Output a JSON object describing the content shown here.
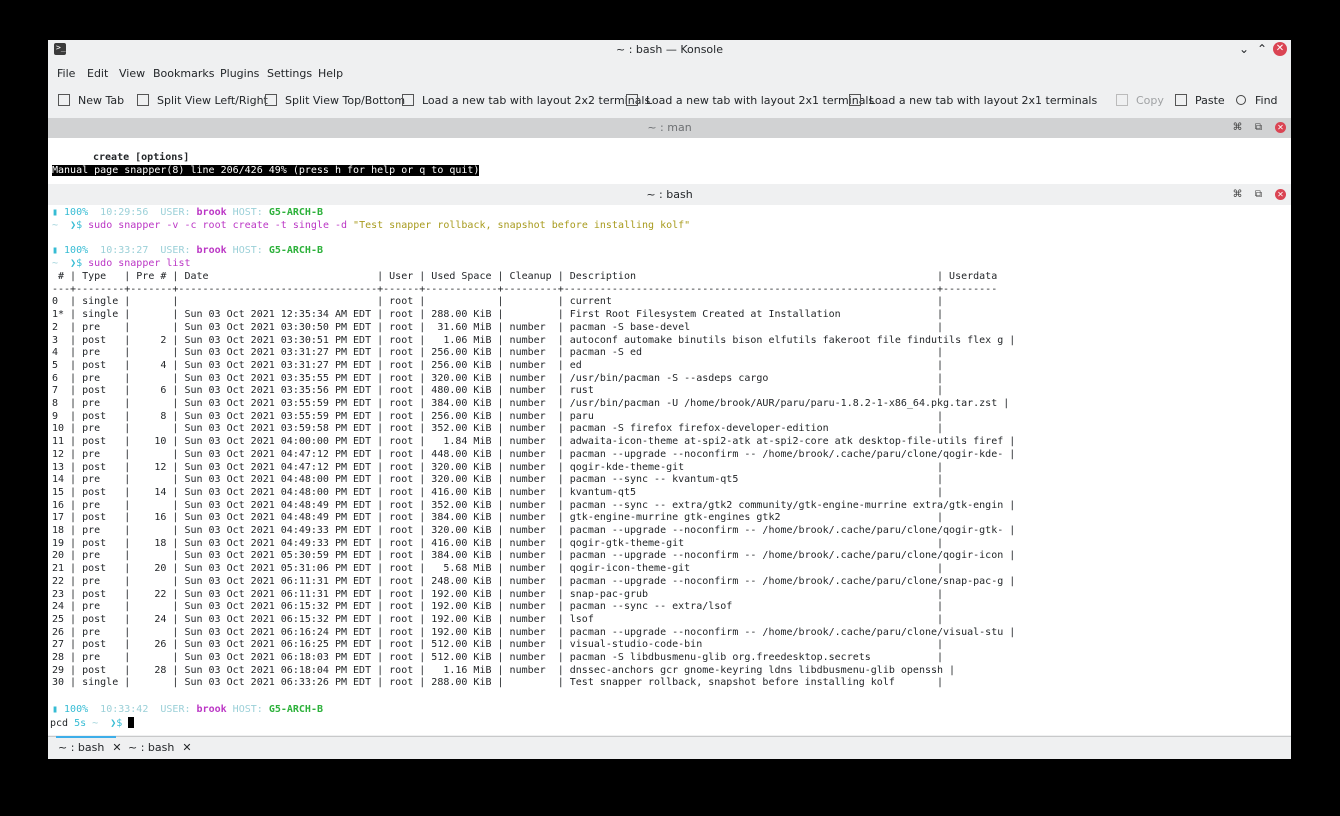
{
  "window": {
    "title": "~ : bash — Konsole"
  },
  "menubar": [
    "File",
    "Edit",
    "View",
    "Bookmarks",
    "Plugins",
    "Settings",
    "Help"
  ],
  "toolbar": {
    "new_tab": "New Tab",
    "split_lr": "Split View Left/Right",
    "split_tb": "Split View Top/Bottom",
    "layout_2x2": "Load a new tab with layout 2x2 terminals",
    "layout_2x1_a": "Load a new tab with layout 2x1 terminals",
    "layout_2x1_b": "Load a new tab with layout 2x1 terminals",
    "copy": "Copy",
    "paste": "Paste",
    "find": "Find"
  },
  "top_split": {
    "title": "~ : man",
    "line1": "create [options]",
    "status": "Manual page snapper(8) line 206/426 49% (press h for help or q to quit)"
  },
  "bottom_split": {
    "title": "~ : bash",
    "prompt1": {
      "battery": "▮ 100%",
      "time": "10:29:56",
      "user_label": "USER:",
      "user": "brook",
      "host_label": "HOST:",
      "host": "G5-ARCH-B",
      "dir": "~ ",
      "arrow": " ❯$ ",
      "cmd_start": "sudo snapper -v -c root create -t single -d ",
      "cmd_str": "\"Test snapper rollback, snapshot before installing kolf\""
    },
    "prompt2": {
      "battery": "▮ 100%",
      "time": "10:33:27",
      "user_label": "USER:",
      "user": "brook",
      "host_label": "HOST:",
      "host": "G5-ARCH-B",
      "dir": "~ ",
      "arrow": " ❯$ ",
      "cmd": "sudo snapper list"
    },
    "table": [
      " # | Type   | Pre # | Date                            | User | Used Space | Cleanup | Description                                                  | Userdata",
      "---+--------+-------+---------------------------------+------+------------+---------+--------------------------------------------------------------+---------",
      "0  | single |       |                                 | root |            |         | current                                                      |",
      "1* | single |       | Sun 03 Oct 2021 12:35:34 AM EDT | root | 288.00 KiB |         | First Root Filesystem Created at Installation                |",
      "2  | pre    |       | Sun 03 Oct 2021 03:30:50 PM EDT | root |  31.60 MiB | number  | pacman -S base-devel                                         |",
      "3  | post   |     2 | Sun 03 Oct 2021 03:30:51 PM EDT | root |   1.06 MiB | number  | autoconf automake binutils bison elfutils fakeroot file findutils flex g |",
      "4  | pre    |       | Sun 03 Oct 2021 03:31:27 PM EDT | root | 256.00 KiB | number  | pacman -S ed                                                 |",
      "5  | post   |     4 | Sun 03 Oct 2021 03:31:27 PM EDT | root | 256.00 KiB | number  | ed                                                           |",
      "6  | pre    |       | Sun 03 Oct 2021 03:35:55 PM EDT | root | 320.00 KiB | number  | /usr/bin/pacman -S --asdeps cargo                            |",
      "7  | post   |     6 | Sun 03 Oct 2021 03:35:56 PM EDT | root | 480.00 KiB | number  | rust                                                         |",
      "8  | pre    |       | Sun 03 Oct 2021 03:55:59 PM EDT | root | 384.00 KiB | number  | /usr/bin/pacman -U /home/brook/AUR/paru/paru-1.8.2-1-x86_64.pkg.tar.zst |",
      "9  | post   |     8 | Sun 03 Oct 2021 03:55:59 PM EDT | root | 256.00 KiB | number  | paru                                                         |",
      "10 | pre    |       | Sun 03 Oct 2021 03:59:58 PM EDT | root | 352.00 KiB | number  | pacman -S firefox firefox-developer-edition                  |",
      "11 | post   |    10 | Sun 03 Oct 2021 04:00:00 PM EDT | root |   1.84 MiB | number  | adwaita-icon-theme at-spi2-atk at-spi2-core atk desktop-file-utils firef |",
      "12 | pre    |       | Sun 03 Oct 2021 04:47:12 PM EDT | root | 448.00 KiB | number  | pacman --upgrade --noconfirm -- /home/brook/.cache/paru/clone/qogir-kde- |",
      "13 | post   |    12 | Sun 03 Oct 2021 04:47:12 PM EDT | root | 320.00 KiB | number  | qogir-kde-theme-git                                          |",
      "14 | pre    |       | Sun 03 Oct 2021 04:48:00 PM EDT | root | 320.00 KiB | number  | pacman --sync -- kvantum-qt5                                 |",
      "15 | post   |    14 | Sun 03 Oct 2021 04:48:00 PM EDT | root | 416.00 KiB | number  | kvantum-qt5                                                  |",
      "16 | pre    |       | Sun 03 Oct 2021 04:48:49 PM EDT | root | 352.00 KiB | number  | pacman --sync -- extra/gtk2 community/gtk-engine-murrine extra/gtk-engin |",
      "17 | post   |    16 | Sun 03 Oct 2021 04:48:49 PM EDT | root | 384.00 KiB | number  | gtk-engine-murrine gtk-engines gtk2                          |",
      "18 | pre    |       | Sun 03 Oct 2021 04:49:33 PM EDT | root | 320.00 KiB | number  | pacman --upgrade --noconfirm -- /home/brook/.cache/paru/clone/qogir-gtk- |",
      "19 | post   |    18 | Sun 03 Oct 2021 04:49:33 PM EDT | root | 416.00 KiB | number  | qogir-gtk-theme-git                                          |",
      "20 | pre    |       | Sun 03 Oct 2021 05:30:59 PM EDT | root | 384.00 KiB | number  | pacman --upgrade --noconfirm -- /home/brook/.cache/paru/clone/qogir-icon |",
      "21 | post   |    20 | Sun 03 Oct 2021 05:31:06 PM EDT | root |   5.68 MiB | number  | qogir-icon-theme-git                                         |",
      "22 | pre    |       | Sun 03 Oct 2021 06:11:31 PM EDT | root | 248.00 KiB | number  | pacman --upgrade --noconfirm -- /home/brook/.cache/paru/clone/snap-pac-g |",
      "23 | post   |    22 | Sun 03 Oct 2021 06:11:31 PM EDT | root | 192.00 KiB | number  | snap-pac-grub                                                |",
      "24 | pre    |       | Sun 03 Oct 2021 06:15:32 PM EDT | root | 192.00 KiB | number  | pacman --sync -- extra/lsof                                  |",
      "25 | post   |    24 | Sun 03 Oct 2021 06:15:32 PM EDT | root | 192.00 KiB | number  | lsof                                                         |",
      "26 | pre    |       | Sun 03 Oct 2021 06:16:24 PM EDT | root | 192.00 KiB | number  | pacman --upgrade --noconfirm -- /home/brook/.cache/paru/clone/visual-stu |",
      "27 | post   |    26 | Sun 03 Oct 2021 06:16:25 PM EDT | root | 512.00 KiB | number  | visual-studio-code-bin                                       |",
      "28 | pre    |       | Sun 03 Oct 2021 06:18:03 PM EDT | root | 512.00 KiB | number  | pacman -S libdbusmenu-glib org.freedesktop.secrets           |",
      "29 | post   |    28 | Sun 03 Oct 2021 06:18:04 PM EDT | root |   1.16 MiB | number  | dnssec-anchors gcr gnome-keyring ldns libdbusmenu-glib openssh |",
      "30 | single |       | Sun 03 Oct 2021 06:33:26 PM EDT | root | 288.00 KiB |         | Test snapper rollback, snapshot before installing kolf       |"
    ],
    "prompt3": {
      "battery": "▮ 100%",
      "time": "10:33:42",
      "user_label": "USER:",
      "user": "brook",
      "host_label": "HOST:",
      "host": "G5-ARCH-B"
    },
    "last_line": {
      "pcd": "pcd",
      "dur": " 5s",
      "dir": " ~ ",
      "arrow": " ❯$ "
    }
  },
  "tabs": [
    {
      "label": "~ : bash"
    },
    {
      "label": "~ : bash"
    }
  ]
}
